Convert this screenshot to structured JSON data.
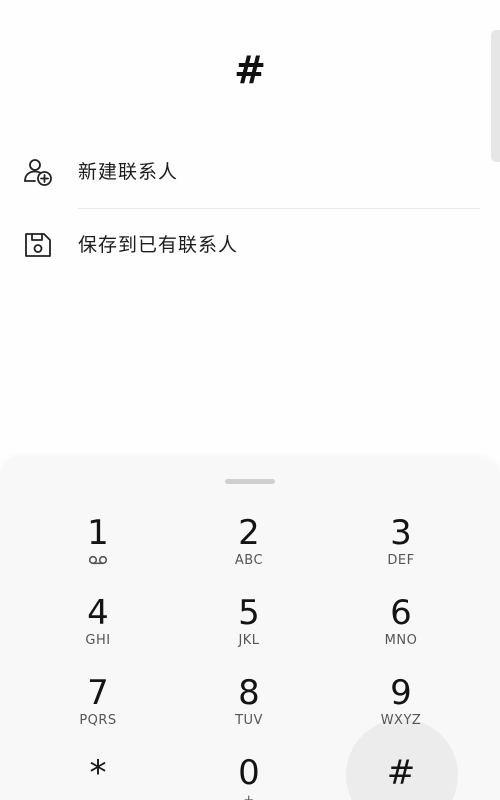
{
  "dial_input": "#",
  "actions": [
    {
      "label": "新建联系人",
      "icon": "add-contact-icon"
    },
    {
      "label": "保存到已有联系人",
      "icon": "save-icon"
    }
  ],
  "keypad": {
    "keys": [
      {
        "digit": "1",
        "letters": "",
        "icon": "voicemail-icon"
      },
      {
        "digit": "2",
        "letters": "ABC"
      },
      {
        "digit": "3",
        "letters": "DEF"
      },
      {
        "digit": "4",
        "letters": "GHI"
      },
      {
        "digit": "5",
        "letters": "JKL"
      },
      {
        "digit": "6",
        "letters": "MNO"
      },
      {
        "digit": "7",
        "letters": "PQRS"
      },
      {
        "digit": "8",
        "letters": "TUV"
      },
      {
        "digit": "9",
        "letters": "WXYZ"
      },
      {
        "digit": "*",
        "letters": ""
      },
      {
        "digit": "0",
        "letters": "+"
      },
      {
        "digit": "#",
        "letters": ""
      }
    ]
  },
  "colors": {
    "keypad_background": "#f8f8f8",
    "text_primary": "#1a1a1a",
    "text_secondary": "#555555",
    "pressed_key_highlight": "#ececec"
  }
}
